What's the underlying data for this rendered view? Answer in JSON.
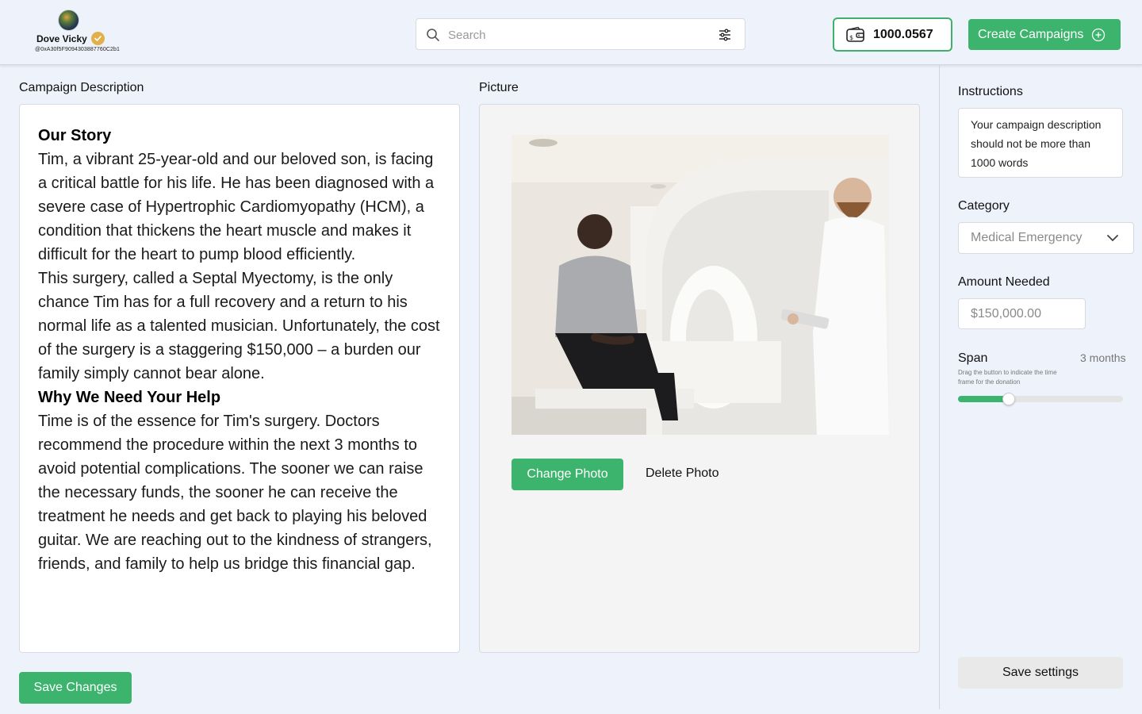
{
  "header": {
    "profile": {
      "name": "Dove Vicky",
      "address": "@0xA30f5F9094303887760C2b1"
    },
    "search": {
      "placeholder": "Search"
    },
    "wallet": {
      "balance": "1000.0567"
    },
    "create_button": "Create Campaigns"
  },
  "main": {
    "description_label": "Campaign Description",
    "picture_label": "Picture",
    "description": [
      {
        "style": "heading",
        "text": "Our Story"
      },
      {
        "style": "body",
        "text": "Tim, a vibrant 25-year-old and our beloved son, is facing a critical battle for his life. He has been diagnosed with a severe case of Hypertrophic Cardiomyopathy (HCM), a condition that thickens the heart muscle and makes it difficult for the heart to pump blood efficiently."
      },
      {
        "style": "body",
        "text": "This surgery, called a Septal Myectomy, is the only chance Tim has for a full recovery and a return to his normal life as a talented musician. Unfortunately, the cost of the surgery is a staggering $150,000 – a burden our family simply cannot bear alone."
      },
      {
        "style": "heading",
        "text": "Why We Need Your Help"
      },
      {
        "style": "body",
        "text": "Time is of the essence for Tim's surgery.  Doctors recommend the procedure within the next 3 months to avoid potential complications. The sooner we can raise the necessary funds, the sooner he can receive the treatment he needs and get back to playing his beloved guitar. We are reaching out to the kindness of strangers, friends, and family to help us bridge this financial gap."
      }
    ],
    "change_photo": "Change Photo",
    "delete_photo": "Delete Photo",
    "save_changes": "Save Changes"
  },
  "settings": {
    "instructions_label": "Instructions",
    "instructions_text": "Your campaign description should not be more than 1000 words",
    "category_label": "Category",
    "category_value": "Medical Emergency",
    "amount_label": "Amount Needed",
    "amount_placeholder": "$150,000.00",
    "span_label": "Span",
    "span_value": "3 months",
    "span_hint": "Drag the button to indicate the time frame for the donation",
    "span_fraction": 0.31,
    "save_settings": "Save settings"
  },
  "colors": {
    "accent": "#3cb46e",
    "background": "#eef2fb"
  }
}
